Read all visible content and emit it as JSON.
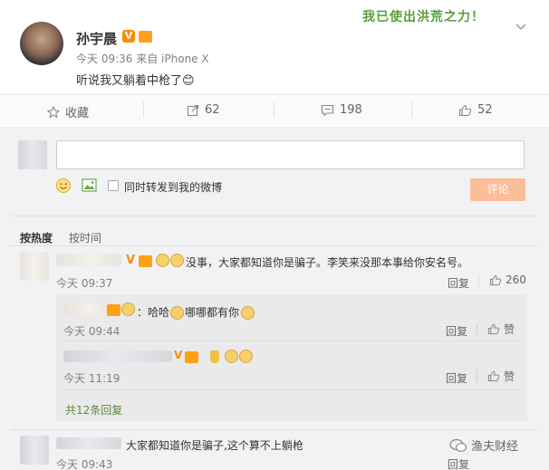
{
  "post": {
    "author": "孙宇晨",
    "time": "今天 09:36",
    "source": "来自 iPhone X",
    "text": "听说我又躺着中枪了😊",
    "banner": "我已使出洪荒之力！"
  },
  "actions": {
    "favorite": "收藏",
    "repost": "62",
    "comment": "198",
    "like": "52"
  },
  "composer": {
    "placeholder": "",
    "also_repost_label": "同时转发到我的微博",
    "submit_label": "评论"
  },
  "sort": {
    "by_hot": "按热度",
    "by_time": "按时间"
  },
  "comments": [
    {
      "text": "没事，大家都知道你是骗子。李笑来没那本事给你安名号。",
      "time": "今天 09:37",
      "reply_label": "回复",
      "likes": "260"
    }
  ],
  "replies": [
    {
      "text": "：哈哈",
      "text2": "哪哪都有你",
      "time": "今天 09:44",
      "reply_label": "回复",
      "like_label": "赞"
    },
    {
      "text": "",
      "time": "今天 11:19",
      "reply_label": "回复",
      "like_label": "赞"
    }
  ],
  "more_replies": "共12条回复",
  "comment2": {
    "text": "大家都知道你是骗子,这个算不上躺枪",
    "time": "今天 09:43",
    "reply_label": "回复"
  },
  "watermark": "渔夫财经",
  "colors": {
    "accent": "#fa7d3c",
    "link": "#4b6b95",
    "badge": "#ff8a00"
  }
}
